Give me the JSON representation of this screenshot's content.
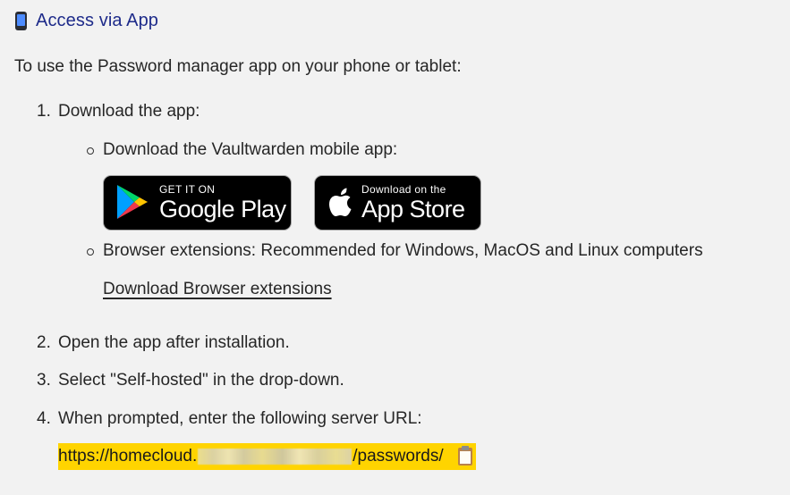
{
  "section": {
    "icon": "mobile-phone-icon",
    "title": "Access via App"
  },
  "intro": "To use the Password manager app on your phone or tablet:",
  "steps": [
    {
      "number": "1.",
      "text": "Download the app:"
    },
    {
      "number": "2.",
      "text": "Open the app after installation."
    },
    {
      "number": "3.",
      "text": "Select \"Self-hosted\" in the drop-down."
    },
    {
      "number": "4.",
      "text": "When prompted, enter the following server URL:"
    }
  ],
  "subitems": [
    {
      "text": "Download the Vaultwarden mobile app:"
    },
    {
      "text": "Browser extensions: Recommended for Windows, MacOS and Linux computers"
    }
  ],
  "badges": {
    "google_play": {
      "small": "GET IT ON",
      "big": "Google Play",
      "icon": "google-play-logo-icon"
    },
    "app_store": {
      "small": "Download on the",
      "big": "App Store",
      "icon": "apple-logo-icon"
    }
  },
  "browser_link": "Download Browser extensions",
  "server_url": {
    "prefix": "https://homecloud.",
    "suffix": "/passwords/",
    "copy_icon": "clipboard-icon",
    "highlight_color": "#ffd400"
  },
  "colors": {
    "heading": "#1e2b8a",
    "background": "#f2f2f2",
    "text": "#262626"
  }
}
